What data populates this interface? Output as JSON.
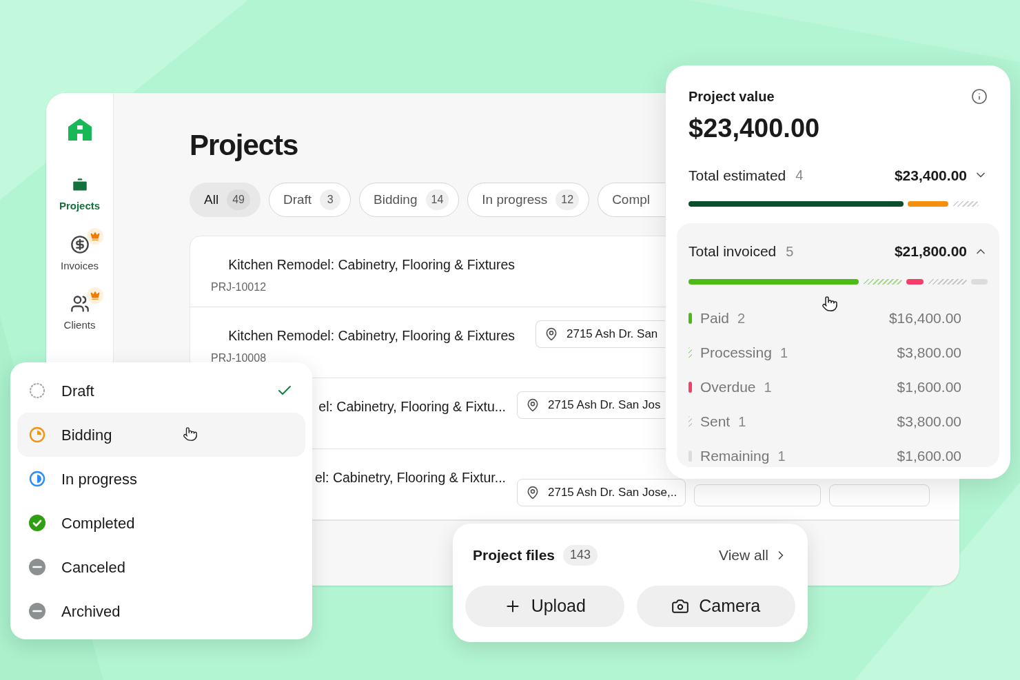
{
  "sidebar": {
    "items": [
      {
        "label": "Projects",
        "kind": "projects",
        "selected": true,
        "premium": false
      },
      {
        "label": "Invoices",
        "kind": "invoices",
        "selected": false,
        "premium": true
      },
      {
        "label": "Clients",
        "kind": "clients",
        "selected": false,
        "premium": true
      }
    ]
  },
  "page": {
    "title": "Projects"
  },
  "filters": [
    {
      "label": "All",
      "count": "49",
      "selected": true
    },
    {
      "label": "Draft",
      "count": "3",
      "selected": false
    },
    {
      "label": "Bidding",
      "count": "14",
      "selected": false
    },
    {
      "label": "In progress",
      "count": "12",
      "selected": false
    },
    {
      "label": "Compl",
      "selected": false
    }
  ],
  "projects": [
    {
      "title": "Kitchen Remodel: Cabinetry, Flooring & Fixtures",
      "id": "PRJ-10012"
    },
    {
      "title": "Kitchen Remodel: Cabinetry, Flooring & Fixtures",
      "id": "PRJ-10008",
      "tags": [
        {
          "kind": "location",
          "text": "2715 Ash Dr. San"
        }
      ]
    },
    {
      "title": "el: Cabinetry, Flooring & Fixtu...",
      "tags": [
        {
          "kind": "location",
          "text": "2715 Ash Dr. San Jos"
        }
      ]
    },
    {
      "title": "el: Cabinetry, Flooring & Fixtur...",
      "tags": [
        {
          "kind": "location",
          "text": "2715 Ash Dr. San Jose,.."
        },
        {
          "kind": "client"
        },
        {
          "kind": "status"
        }
      ]
    }
  ],
  "status_menu": [
    {
      "label": "Draft",
      "kind": "draft",
      "checked": true,
      "highlighted": false
    },
    {
      "label": "Bidding",
      "kind": "bidding",
      "checked": false,
      "highlighted": true
    },
    {
      "label": "In progress",
      "kind": "in_progress",
      "checked": false,
      "highlighted": false
    },
    {
      "label": "Completed",
      "kind": "completed",
      "checked": false,
      "highlighted": false
    },
    {
      "label": "Canceled",
      "kind": "canceled",
      "checked": false,
      "highlighted": false
    },
    {
      "label": "Archived",
      "kind": "archived",
      "checked": false,
      "highlighted": false
    }
  ],
  "value_card": {
    "title": "Project value",
    "amount": "$23,400.00",
    "estimated": {
      "label": "Total estimated",
      "count": "4",
      "amount": "$23,400.00",
      "expanded": false,
      "segments": [
        {
          "kind": "solid",
          "color": "#0b4f2d"
        },
        {
          "kind": "solid",
          "color": "#f5900f"
        },
        {
          "kind": "hatched",
          "color": "#cfcfcf"
        }
      ]
    },
    "invoiced": {
      "label": "Total invoiced",
      "count": "5",
      "amount": "$21,800.00",
      "expanded": true,
      "breakdown": [
        {
          "label": "Paid",
          "count": "2",
          "amount": "$16,400.00",
          "kind": "solid",
          "color": "#4cbb17"
        },
        {
          "label": "Processing",
          "count": "1",
          "amount": "$3,800.00",
          "kind": "hatched",
          "color": "#a9d98f"
        },
        {
          "label": "Overdue",
          "count": "1",
          "amount": "$1,600.00",
          "kind": "solid",
          "color": "#f43f6a"
        },
        {
          "label": "Sent",
          "count": "1",
          "amount": "$3,800.00",
          "kind": "hatched",
          "color": "#c8c8c8"
        },
        {
          "label": "Remaining",
          "count": "1",
          "amount": "$1,600.00",
          "kind": "solid",
          "color": "#dcdcdc"
        }
      ]
    }
  },
  "files": {
    "title": "Project files",
    "count": "143",
    "link": "View all",
    "actions": [
      {
        "label": "Upload",
        "kind": "upload"
      },
      {
        "label": "Camera",
        "kind": "camera"
      }
    ]
  }
}
